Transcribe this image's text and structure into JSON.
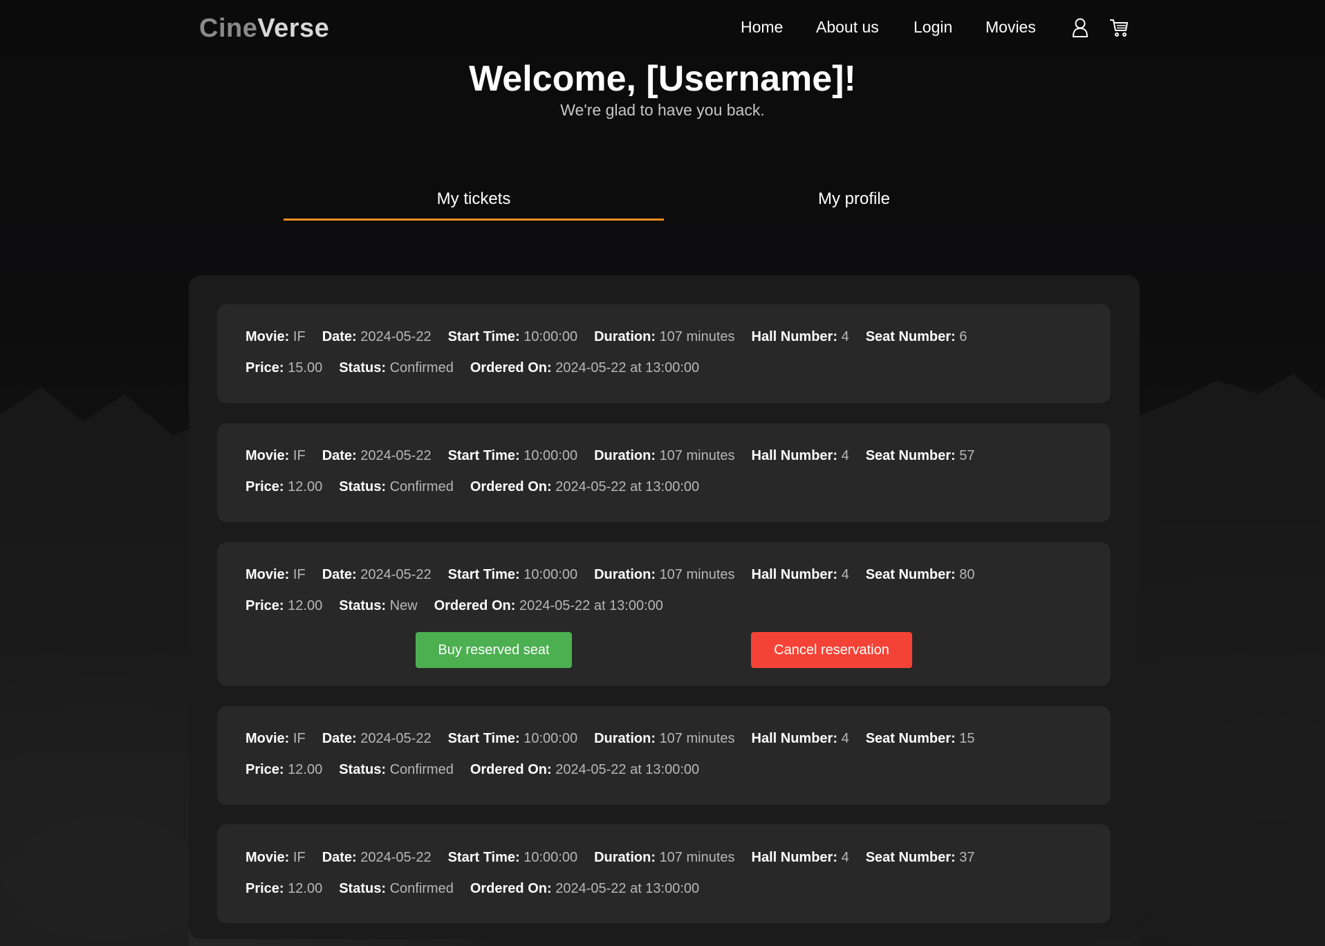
{
  "header": {
    "brand_part1": "Cine",
    "brand_part2": "Verse",
    "nav": [
      "Home",
      "About us",
      "Login",
      "Movies"
    ],
    "icons": [
      "user-icon",
      "cart-icon"
    ]
  },
  "welcome": {
    "title": "Welcome, [Username]!",
    "subtitle": "We're glad to have you back."
  },
  "tabs": {
    "items": [
      "My tickets",
      "My profile"
    ],
    "active": "My tickets"
  },
  "labels": {
    "movie": "Movie:",
    "date": "Date:",
    "start_time": "Start Time:",
    "duration": "Duration:",
    "hall_number": "Hall Number:",
    "seat_number": "Seat Number:",
    "price": "Price:",
    "status": "Status:",
    "ordered_on": "Ordered On:"
  },
  "tickets": [
    {
      "movie": "IF",
      "date": "2024-05-22",
      "start_time": "10:00:00",
      "duration": "107 minutes",
      "hall_number": "4",
      "seat_number": "6",
      "price": "15.00",
      "status": "Confirmed",
      "ordered_on": "2024-05-22 at 13:00:00"
    },
    {
      "movie": "IF",
      "date": "2024-05-22",
      "start_time": "10:00:00",
      "duration": "107 minutes",
      "hall_number": "4",
      "seat_number": "57",
      "price": "12.00",
      "status": "Confirmed",
      "ordered_on": "2024-05-22 at 13:00:00"
    },
    {
      "movie": "IF",
      "date": "2024-05-22",
      "start_time": "10:00:00",
      "duration": "107 minutes",
      "hall_number": "4",
      "seat_number": "80",
      "price": "12.00",
      "status": "New",
      "ordered_on": "2024-05-22 at 13:00:00"
    },
    {
      "movie": "IF",
      "date": "2024-05-22",
      "start_time": "10:00:00",
      "duration": "107 minutes",
      "hall_number": "4",
      "seat_number": "15",
      "price": "12.00",
      "status": "Confirmed",
      "ordered_on": "2024-05-22 at 13:00:00"
    },
    {
      "movie": "IF",
      "date": "2024-05-22",
      "start_time": "10:00:00",
      "duration": "107 minutes",
      "hall_number": "4",
      "seat_number": "37",
      "price": "12.00",
      "status": "Confirmed",
      "ordered_on": "2024-05-22 at 13:00:00"
    }
  ],
  "actions": {
    "buy_label": "Buy reserved seat",
    "cancel_label": "Cancel reservation"
  },
  "colors": {
    "accent": "#f08d1e",
    "buy": "#4caf50",
    "cancel": "#f44336",
    "card": "#282828",
    "panel": "#1b1b1b"
  }
}
